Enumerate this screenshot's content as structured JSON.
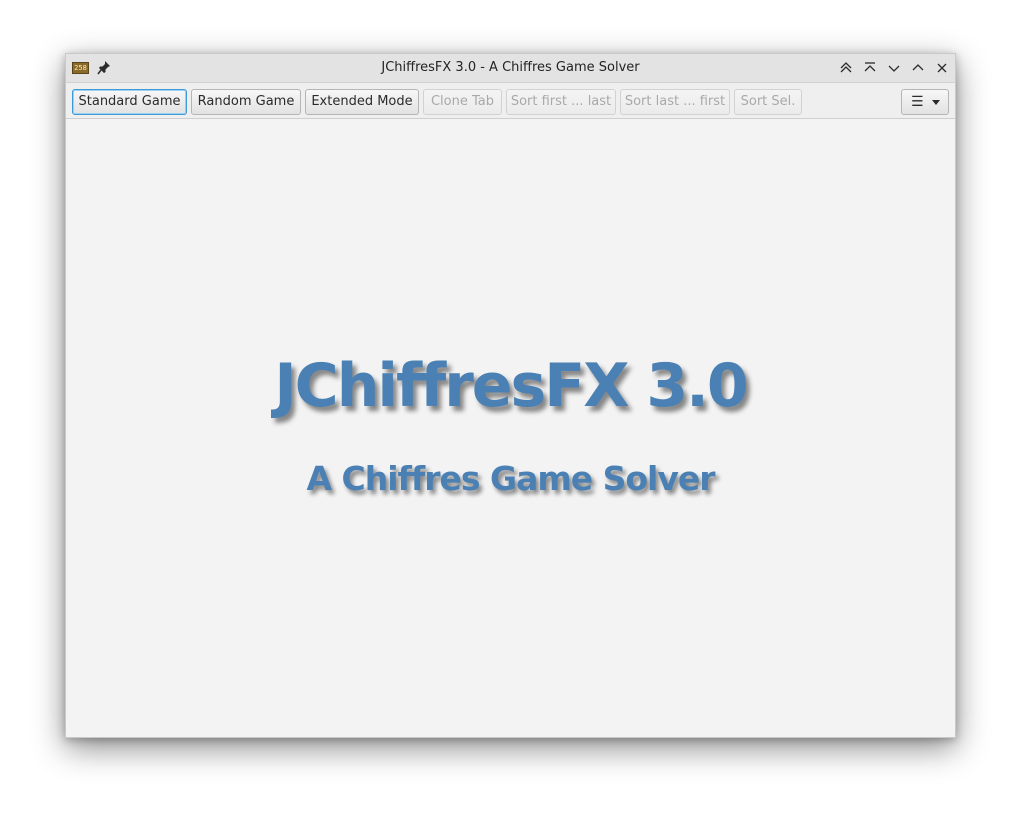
{
  "window": {
    "title": "JChiffresFX 3.0 - A Chiffres Game Solver",
    "app_icon_text": "258",
    "controls": [
      "keep-above-icon",
      "shade-icon",
      "minimize-icon",
      "maximize-icon",
      "close-icon"
    ]
  },
  "toolbar": {
    "buttons": [
      {
        "label": "Standard Game",
        "enabled": true,
        "focused": true
      },
      {
        "label": "Random Game",
        "enabled": true
      },
      {
        "label": "Extended Mode",
        "enabled": true
      },
      {
        "label": "Clone Tab",
        "enabled": false
      },
      {
        "label": "Sort first ... last",
        "enabled": false
      },
      {
        "label": "Sort last ... first",
        "enabled": false
      },
      {
        "label": "Sort Sel.",
        "enabled": false
      }
    ],
    "menu_icon": "☰"
  },
  "splash": {
    "title": "JChiffresFX 3.0",
    "subtitle": "A Chiffres Game Solver",
    "color": "#4a80b3"
  }
}
